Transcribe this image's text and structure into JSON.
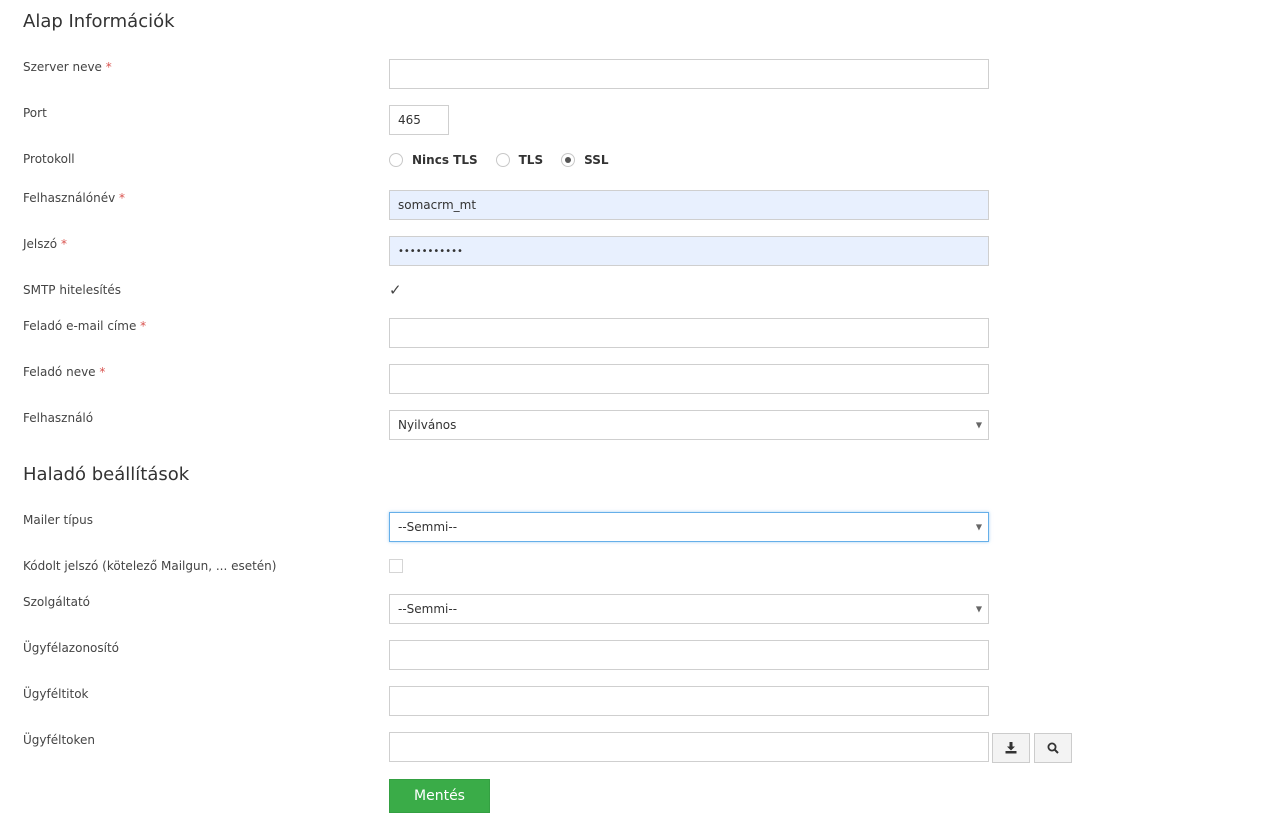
{
  "sections": {
    "basic_title": "Alap Információk",
    "advanced_title": "Haladó beállítások"
  },
  "fields": {
    "server_name": {
      "label": "Szerver neve",
      "value": ""
    },
    "port": {
      "label": "Port",
      "value": "465"
    },
    "protocol": {
      "label": "Protokoll",
      "options": [
        "Nincs TLS",
        "TLS",
        "SSL"
      ],
      "selected": "SSL"
    },
    "username": {
      "label": "Felhasználónév",
      "value": "somacrm_mt"
    },
    "password": {
      "label": "Jelszó",
      "value": "•••••••••••"
    },
    "smtp_auth": {
      "label": "SMTP hitelesítés",
      "checked": true
    },
    "sender_email": {
      "label": "Feladó e-mail címe",
      "value": ""
    },
    "sender_name": {
      "label": "Feladó neve",
      "value": ""
    },
    "user": {
      "label": "Felhasználó",
      "value": "Nyilvános"
    },
    "mailer_type": {
      "label": "Mailer típus",
      "value": "--Semmi--"
    },
    "encoded_password": {
      "label": "Kódolt jelszó (kötelező Mailgun, ... esetén)",
      "checked": false
    },
    "provider": {
      "label": "Szolgáltató",
      "value": "--Semmi--"
    },
    "client_id": {
      "label": "Ügyfélazonosító",
      "value": ""
    },
    "client_secret": {
      "label": "Ügyféltitok",
      "value": ""
    },
    "client_token": {
      "label": "Ügyféltoken",
      "value": ""
    }
  },
  "required_marker": "*",
  "icons": {
    "download": "download-icon",
    "search": "search-icon",
    "check": "checkmark-icon",
    "dropdown": "chevron-down-icon"
  },
  "buttons": {
    "save": "Mentés"
  },
  "colors": {
    "save_button": "#3aac48",
    "required": "#d9534f",
    "autofill_bg": "#e8f0fe",
    "focus_border": "#66afe9"
  }
}
